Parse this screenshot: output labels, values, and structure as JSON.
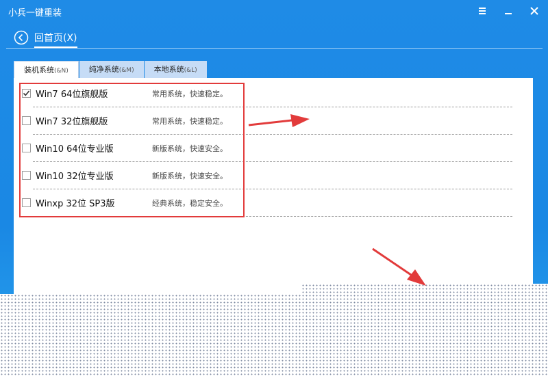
{
  "window": {
    "title": "小兵一键重装",
    "menu_icon": "menu-icon",
    "minimize_icon": "minimize-icon",
    "close_icon": "close-icon"
  },
  "nav": {
    "back_icon": "back-arrow-circle-icon",
    "home_label": "回首页(X)"
  },
  "tabs": [
    {
      "label": "装机系统",
      "hotkey": "(&N)",
      "active": true
    },
    {
      "label": "纯净系统",
      "hotkey": "(&M)",
      "active": false
    },
    {
      "label": "本地系统",
      "hotkey": "(&L)",
      "active": false
    }
  ],
  "systems": [
    {
      "name": "Win7 64位旗舰版",
      "desc": "常用系统，快速稳定。",
      "checked": true
    },
    {
      "name": "Win7 32位旗舰版",
      "desc": "常用系统，快速稳定。",
      "checked": false
    },
    {
      "name": "Win10 64位专业版",
      "desc": "新版系统，快速安全。",
      "checked": false
    },
    {
      "name": "Win10 32位专业版",
      "desc": "新版系统，快速安全。",
      "checked": false
    },
    {
      "name": "Winxp 32位 SP3版",
      "desc": "经典系统，稳定安全。",
      "checked": false
    }
  ],
  "colors": {
    "accent": "#1f8be6",
    "annotation_red": "#e23b3b",
    "tab_inactive": "#c6dcf6"
  }
}
